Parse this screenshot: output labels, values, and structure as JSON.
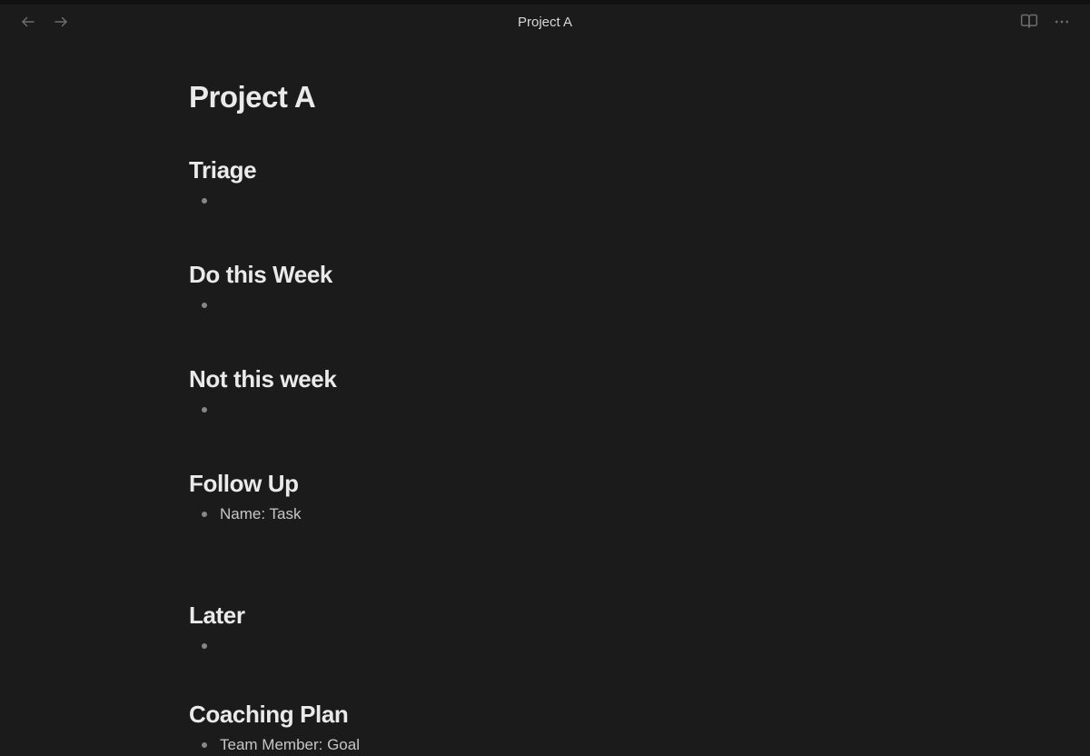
{
  "toolbar": {
    "title": "Project A"
  },
  "page": {
    "title": "Project A",
    "sections": [
      {
        "heading": "Triage",
        "items": [
          ""
        ]
      },
      {
        "heading": "Do this Week",
        "items": [
          ""
        ]
      },
      {
        "heading": "Not this week",
        "items": [
          ""
        ]
      },
      {
        "heading": "Follow Up",
        "items": [
          "Name: Task"
        ]
      },
      {
        "heading": "Later",
        "items": [
          ""
        ]
      },
      {
        "heading": "Coaching Plan",
        "items": [
          "Team Member: Goal"
        ]
      }
    ]
  }
}
